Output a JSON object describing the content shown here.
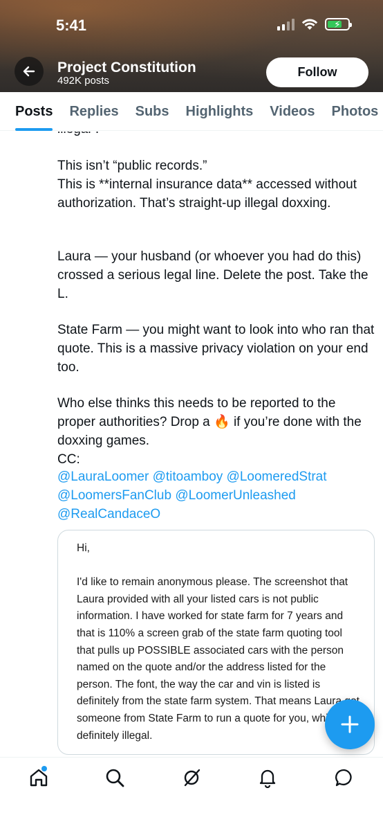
{
  "status_bar": {
    "time": "5:41"
  },
  "header": {
    "profile_name": "Project Constitution",
    "post_count": "492K posts",
    "follow_label": "Follow"
  },
  "tabs": [
    {
      "label": "Posts",
      "active": true
    },
    {
      "label": "Replies"
    },
    {
      "label": "Subs"
    },
    {
      "label": "Highlights"
    },
    {
      "label": "Videos"
    },
    {
      "label": "Photos"
    }
  ],
  "post": {
    "cut_line": "illegal”.",
    "paragraph1": "This isn’t “public records.”\nThis is **internal insurance data** accessed without authorization. That’s straight-up illegal doxxing.",
    "paragraph2": "Laura — your husband (or whoever you had do this) crossed a serious legal line. Delete the post. Take the L.",
    "paragraph3": "State Farm — you might want to look into who ran that quote. This is a massive privacy violation on your end too.",
    "paragraph4": "Who else thinks this needs to be reported to the proper authorities? Drop a 🔥 if you’re done with the doxxing games.\nCC:",
    "mentions": [
      "@LauraLoomer",
      "@titoamboy",
      "@LoomeredStrat",
      "@LoomersFanClub",
      "@LoomerUnleashed",
      "@RealCandaceO"
    ]
  },
  "embedded_image": {
    "text": "Hi,\n\nI'd like to remain anonymous please. The screenshot that Laura provided with all your listed cars is not public information. I have worked for state farm for 7 years and that is 110% a screen grab of the state farm quoting tool that pulls up POSSIBLE associated cars with the person named on the quote and/or the address listed for the person. The font, the way the car and vin is listed is definitely from the state farm system. That means Laura got someone from State Farm to run a quote for you, which is definitely illegal."
  },
  "colors": {
    "accent": "#1d9bf0",
    "text": "#0f1419",
    "muted": "#536471"
  },
  "icons": {
    "back": "arrow-left-icon",
    "compose": "plus-icon",
    "nav": [
      "home-icon",
      "search-icon",
      "grok-icon",
      "bell-icon",
      "message-icon"
    ]
  }
}
